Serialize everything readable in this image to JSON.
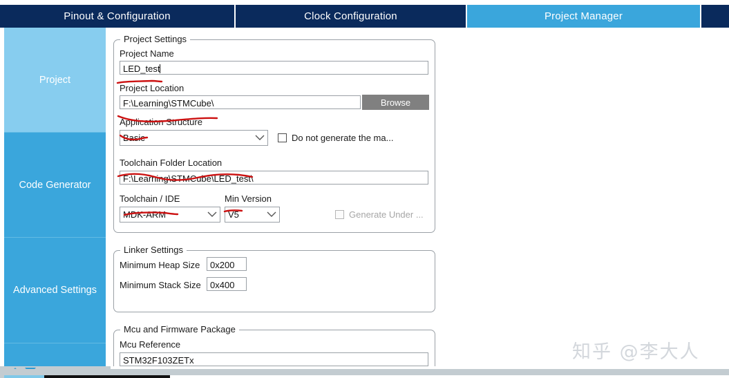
{
  "tabs": [
    {
      "label": "Pinout & Configuration",
      "selected": false
    },
    {
      "label": "Clock Configuration",
      "selected": false
    },
    {
      "label": "Project Manager",
      "selected": true
    }
  ],
  "sidebar": {
    "items": [
      {
        "label": "Project",
        "selected": true
      },
      {
        "label": "Code Generator",
        "selected": false
      },
      {
        "label": "Advanced Settings",
        "selected": false
      },
      {
        "label": "",
        "selected": false
      }
    ],
    "scroll_up_icon": "triangle-up-icon",
    "scroll_down_icon": "triangle-down-icon"
  },
  "project_settings": {
    "legend": "Project Settings",
    "project_name_label": "Project Name",
    "project_name_value": "LED_test",
    "project_location_label": "Project Location",
    "project_location_value": "F:\\Learning\\STMCube\\",
    "browse_label": "Browse",
    "application_structure_label": "Application Structure",
    "application_structure_value": "Basic",
    "do_not_generate_label": "Do not generate the ma...",
    "do_not_generate_checked": false,
    "toolchain_folder_label": "Toolchain Folder Location",
    "toolchain_folder_value": "F:\\Learning\\STMCube\\LED_test\\",
    "toolchain_ide_label": "Toolchain / IDE",
    "toolchain_ide_value": "MDK-ARM",
    "min_version_label": "Min Version",
    "min_version_value": "V5",
    "generate_under_label": "Generate Under ...",
    "generate_under_checked": false,
    "generate_under_disabled": true
  },
  "linker_settings": {
    "legend": "Linker Settings",
    "heap_label": "Minimum Heap Size",
    "heap_value": "0x200",
    "stack_label": "Minimum Stack Size",
    "stack_value": "0x400"
  },
  "mcu_package": {
    "legend": "Mcu and Firmware Package",
    "mcu_reference_label": "Mcu Reference",
    "mcu_reference_value": "STM32F103ZETx"
  },
  "watermark": {
    "text": "知乎 @李大人"
  },
  "colors": {
    "tab_bar": "#0a2a5c",
    "tab_selected": "#3aa6dc",
    "sidebar": "#3aa6dc",
    "sidebar_selected": "#87cdef",
    "annotation": "#cc1111",
    "button": "#808080"
  }
}
